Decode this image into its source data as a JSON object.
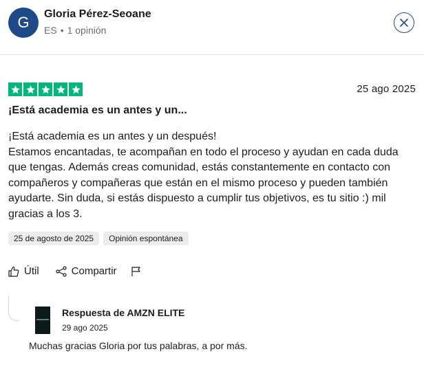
{
  "user": {
    "initial": "G",
    "name": "Gloria Pérez-Seoane",
    "country": "ES",
    "separator": "•",
    "review_count": "1 opinión",
    "avatar_color": "#1f4a8a"
  },
  "review": {
    "rating": 5,
    "rating_max": 5,
    "star_color": "#00b67a",
    "date": "25 ago 2025",
    "title": "¡Está academia es un antes y un...",
    "body_lines": [
      "¡Está academia es un antes y un después!",
      "Estamos encantadas, te acompañan en todo el proceso y ayudan en cada duda",
      "que tengas. Además creas comunidad, estás constantemente en contacto con",
      "compañeros y compañeras que están en el mismo proceso y pueden también",
      "ayudarte. Sin duda, si estás dispuesto a cumplir tus objetivos, es tu sitio :) mil",
      "gracias a los 3."
    ],
    "tags": [
      "25 de agosto de 2025",
      "Opinión espontánea"
    ]
  },
  "actions": {
    "useful_label": "Útil",
    "share_label": "Compartir"
  },
  "reply": {
    "author": "Respuesta de AMZN ELITE",
    "date": "29 ago 2025",
    "text": "Muchas gracias Gloria por tus palabras, a por más."
  },
  "icons": {
    "close": "close-icon",
    "star": "star-icon",
    "thumbs_up": "thumbs-up-icon",
    "share": "share-icon",
    "flag": "flag-icon"
  }
}
